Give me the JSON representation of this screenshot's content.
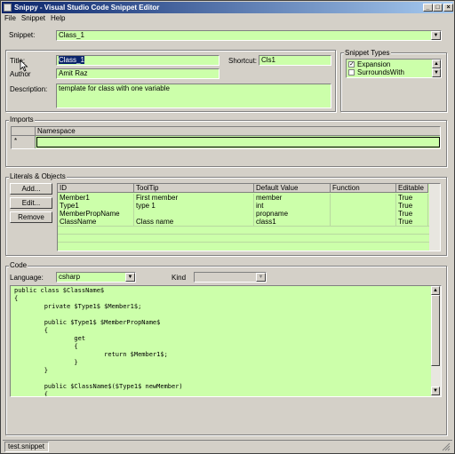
{
  "window": {
    "title": "Snippy - Visual Studio Code Snippet Editor"
  },
  "menu": [
    {
      "label": "File"
    },
    {
      "label": "Snippet"
    },
    {
      "label": "Help"
    }
  ],
  "snippet": {
    "label": "Snippet:",
    "value": "Class_1"
  },
  "header": {
    "title_label": "Title:",
    "title_value": "Class_1",
    "shortcut_label": "Shortcut:",
    "shortcut_value": "Cls1",
    "author_label": "Author",
    "author_value": "Amit Raz",
    "description_label": "Description:",
    "description_value": "template for class with one variable"
  },
  "snippet_types": {
    "label": "Snippet Types",
    "items": [
      {
        "label": "Expansion",
        "checked": true
      },
      {
        "label": "SurroundsWith",
        "checked": false
      }
    ]
  },
  "imports": {
    "label": "Imports",
    "column": "Namespace",
    "new_row_marker": "*"
  },
  "literals": {
    "label": "Literals & Objects",
    "buttons": {
      "add": "Add...",
      "edit": "Edit...",
      "remove": "Remove"
    },
    "columns": [
      "ID",
      "ToolTip",
      "Default Value",
      "Function",
      "Editable"
    ],
    "rows": [
      [
        "Member1",
        "First member",
        "member",
        "",
        "True"
      ],
      [
        "Type1",
        "type 1",
        "int",
        "",
        "True"
      ],
      [
        "MemberPropName",
        "",
        "propname",
        "",
        "True"
      ],
      [
        "ClassName",
        "Class name",
        "class1",
        "",
        "True"
      ]
    ]
  },
  "code": {
    "label": "Code",
    "language_label": "Language:",
    "language_value": "csharp",
    "kind_label": "Kind",
    "kind_value": "",
    "lines": [
      "public class $ClassName$",
      "{",
      "        private $Type1$ $Member1$;",
      "",
      "        public $Type1$ $MemberPropName$",
      "        {",
      "                get",
      "                {",
      "                        return $Member1$;",
      "                }",
      "        }",
      "",
      "        public $ClassName$($Type1$ newMember)",
      "        {"
    ]
  },
  "status": {
    "file": "test.snippet"
  },
  "colors": {
    "field_bg": "#ccffaa",
    "window_bg": "#d4d0c8",
    "title_start": "#0a246a",
    "title_end": "#a6caf0"
  }
}
